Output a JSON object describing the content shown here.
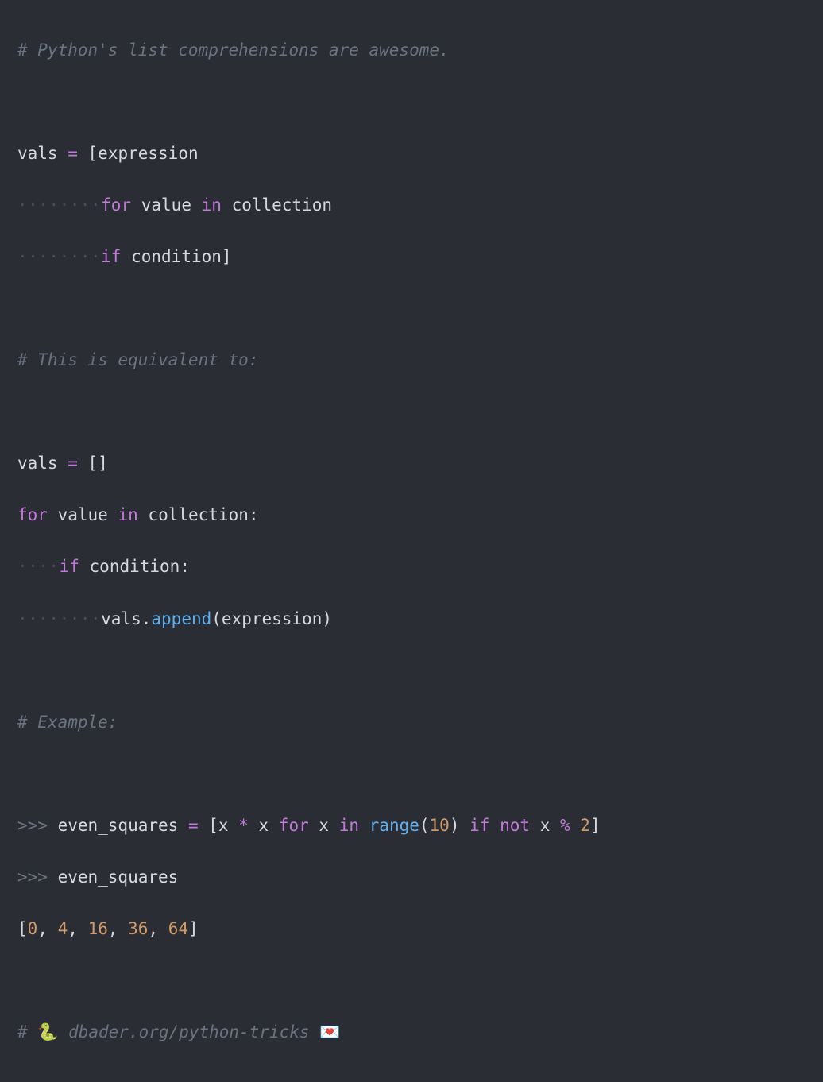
{
  "code": {
    "c1": "# Python's list comprehensions are awesome.",
    "vals": "vals",
    "eq": " = ",
    "lbr": "[",
    "rbr": "]",
    "expression": "expression",
    "dots8": "········",
    "dots4": "····",
    "for": "for",
    "sp": " ",
    "value": "value",
    "in": "in",
    "collection": "collection",
    "if": "if",
    "condition": "condition",
    "c2": "# This is equivalent to:",
    "empty_list": "[]",
    "colon": ":",
    "dot": ".",
    "append": "append",
    "lpar": "(",
    "rpar": ")",
    "c3": "# Example:",
    "prompt": ">>> ",
    "even_squares": "even_squares",
    "x": "x",
    "star": " * ",
    "range": "range",
    "ten": "10",
    "not": "not",
    "mod": " % ",
    "two": "2",
    "result_open": "[",
    "r0": "0",
    "comma": ", ",
    "r1": "4",
    "r2": "16",
    "r3": "36",
    "r4": "64",
    "result_close": "]",
    "c4a": "# ",
    "snake": "🐍",
    "c4b": " dbader.org/python-tricks ",
    "heart": "💌"
  }
}
